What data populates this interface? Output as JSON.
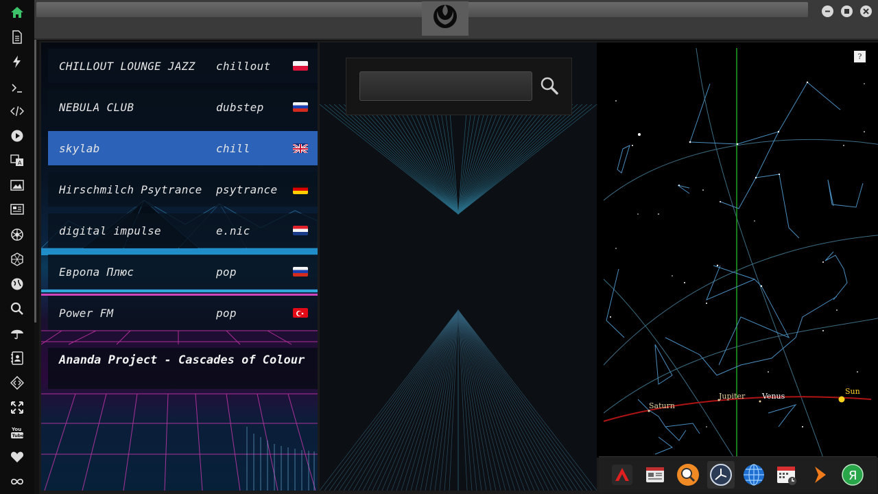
{
  "sidebar": {
    "icons": [
      "home-icon",
      "document-icon",
      "bolt-icon",
      "terminal-icon",
      "code-icon",
      "play-icon",
      "translate-icon",
      "image-icon",
      "news-icon",
      "aperture-icon",
      "hexagon-icon",
      "globe-icon",
      "search-icon",
      "umbrella-icon",
      "contacts-icon",
      "tag-code-icon",
      "expand-icon",
      "youtube-icon",
      "heart-icon",
      "infinity-icon"
    ],
    "accent": "#3cc36a"
  },
  "titlebar": {
    "logo": "rebel-alliance-logo"
  },
  "stations": [
    {
      "name": "CHILLOUT LOUNGE JAZZ",
      "genre": "chillout",
      "flag": "poland"
    },
    {
      "name": "NEBULA CLUB",
      "genre": "dubstep",
      "flag": "russia"
    },
    {
      "name": "skylab",
      "genre": "chill",
      "flag": "uk",
      "active": true
    },
    {
      "name": "Hirschmilch Psytrance",
      "genre": "psytrance",
      "flag": "germany"
    },
    {
      "name": "digital impulse",
      "genre": "e.nic",
      "flag": "croatia"
    },
    {
      "name": "Европа Плюс",
      "genre": "pop",
      "flag": "russia"
    },
    {
      "name": "Power FM",
      "genre": "pop",
      "flag": "turkey"
    }
  ],
  "now_playing": {
    "title": "Ananda Project - Cascades of Colour"
  },
  "search": {
    "value": "",
    "placeholder": ""
  },
  "sky": {
    "help_label": "?",
    "planets": {
      "saturn": "Saturn",
      "jupiter": "Jupiter",
      "venus": "Venus",
      "sun": "Sun"
    },
    "planet_color": "#e6d2a0",
    "sun_color": "#ffd21e"
  },
  "dock": {
    "items": [
      "arch-icon",
      "newspaper-icon",
      "search-app-icon",
      "clock-icon",
      "globe-icon",
      "calendar-icon",
      "arrow-icon",
      "yandex-icon"
    ],
    "active_index": 3
  }
}
